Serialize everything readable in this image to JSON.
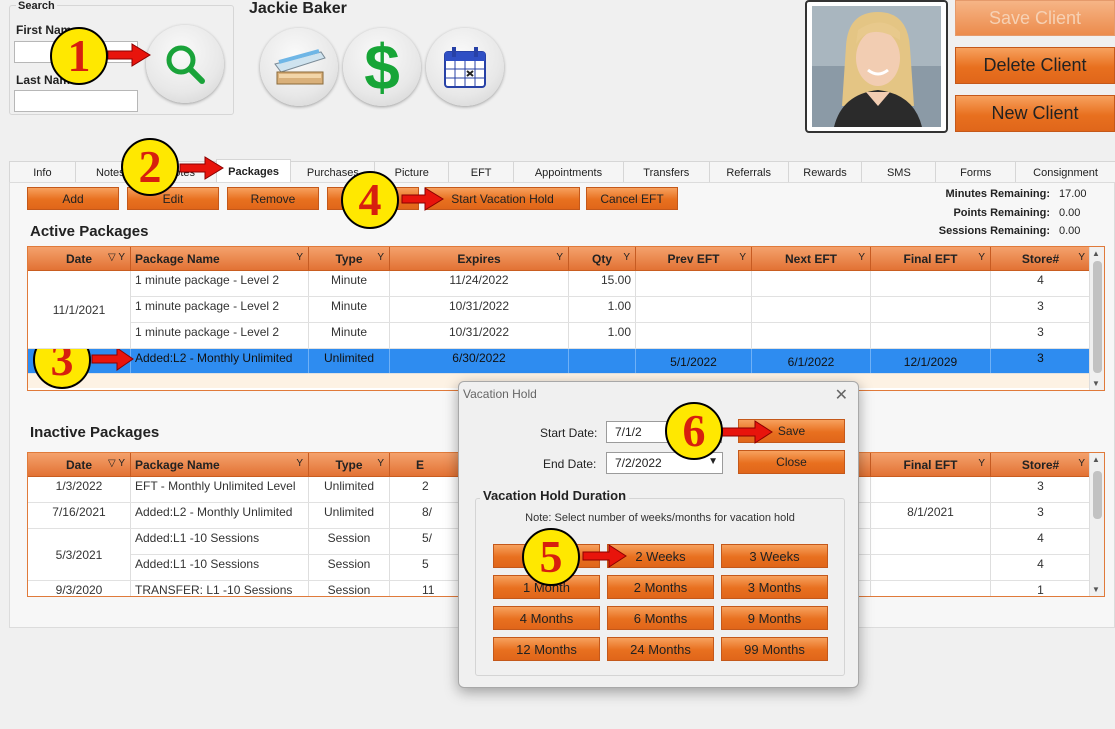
{
  "client_name": "Jackie Baker",
  "search": {
    "legend": "Search",
    "first_name_label": "First Name",
    "last_name_label": "Last Name",
    "first_name_value": "",
    "last_name_value": ""
  },
  "client_buttons": {
    "save": "Save Client",
    "delete": "Delete Client",
    "new": "New Client"
  },
  "tabs": [
    "Info",
    "Notes",
    "Notes",
    "Packages",
    "Purchases",
    "Picture",
    "EFT",
    "Appointments",
    "Transfers",
    "Referrals",
    "Rewards",
    "SMS",
    "Forms",
    "Consignment"
  ],
  "active_tab": "Packages",
  "toolbar": {
    "add": "Add",
    "edit": "Edit",
    "remove": "Remove",
    "start_vacation": "Start Vacation Hold",
    "cancel_eft": "Cancel EFT"
  },
  "stats": {
    "minutes_label": "Minutes Remaining:",
    "minutes_value": "17.00",
    "points_label": "Points Remaining:",
    "points_value": "0.00",
    "sessions_label": "Sessions Remaining:",
    "sessions_value": "0.00"
  },
  "active_packages": {
    "title": "Active Packages",
    "columns": [
      "Date",
      "Package Name",
      "Type",
      "Expires",
      "Qty",
      "Prev EFT",
      "Next EFT",
      "Final EFT",
      "Store#"
    ],
    "rows": [
      {
        "date": "11/1/2021",
        "name": "1 minute package - Level 2",
        "type": "Minute",
        "expires": "11/24/2022",
        "qty": "15.00",
        "prev": "",
        "next": "",
        "final": "",
        "store": "4"
      },
      {
        "date": "",
        "name": "1 minute package - Level 2",
        "type": "Minute",
        "expires": "10/31/2022",
        "qty": "1.00",
        "prev": "",
        "next": "",
        "final": "",
        "store": "3"
      },
      {
        "date": "",
        "name": "1 minute package - Level 2",
        "type": "Minute",
        "expires": "10/31/2022",
        "qty": "1.00",
        "prev": "",
        "next": "",
        "final": "",
        "store": "3"
      },
      {
        "date": "",
        "name": "Added:L2 - Monthly Unlimited",
        "type": "Unlimited",
        "expires": "6/30/2022",
        "qty": "",
        "prev": "5/1/2022",
        "next": "6/1/2022",
        "final": "12/1/2029",
        "store": "3"
      }
    ]
  },
  "inactive_packages": {
    "title": "Inactive Packages",
    "columns": [
      "Date",
      "Package Name",
      "Type",
      "E",
      "Final EFT",
      "Store#"
    ],
    "rows": [
      {
        "date": "1/3/2022",
        "name": "EFT - Monthly Unlimited Level",
        "type": "Unlimited",
        "exp": "2",
        "final": "",
        "store": "3"
      },
      {
        "date": "7/16/2021",
        "name": "Added:L2 - Monthly Unlimited",
        "type": "Unlimited",
        "exp": "8/",
        "final": "8/1/2021",
        "store": "3"
      },
      {
        "date": "5/3/2021",
        "name": "Added:L1 -10 Sessions",
        "type": "Session",
        "exp": "5/",
        "final": "",
        "store": "4"
      },
      {
        "date": "",
        "name": "Added:L1 -10 Sessions",
        "type": "Session",
        "exp": "5",
        "final": "",
        "store": "4"
      },
      {
        "date": "9/3/2020",
        "name": "TRANSFER: L1 -10 Sessions",
        "type": "Session",
        "exp": "11",
        "final": "",
        "store": "1"
      }
    ]
  },
  "dialog": {
    "title": "Vacation Hold",
    "start_label": "Start Date:",
    "start_value": "7/1/2",
    "end_label": "End Date:",
    "end_value": "7/2/2022",
    "save": "Save",
    "close": "Close",
    "duration_title": "Vacation Hold Duration",
    "note": "Note: Select number of weeks/months for vacation hold",
    "durations": [
      "1 Week",
      "2 Weeks",
      "3 Weeks",
      "1 Month",
      "2 Months",
      "3 Months",
      "4 Months",
      "6 Months",
      "9 Months",
      "12 Months",
      "24 Months",
      "99 Months"
    ]
  },
  "callouts": [
    "1",
    "2",
    "3",
    "4",
    "5",
    "6"
  ],
  "colors": {
    "accent": "#e8701f",
    "selection": "#2e8cf0",
    "callout": "#ffe800",
    "arrow": "#e8140c"
  }
}
